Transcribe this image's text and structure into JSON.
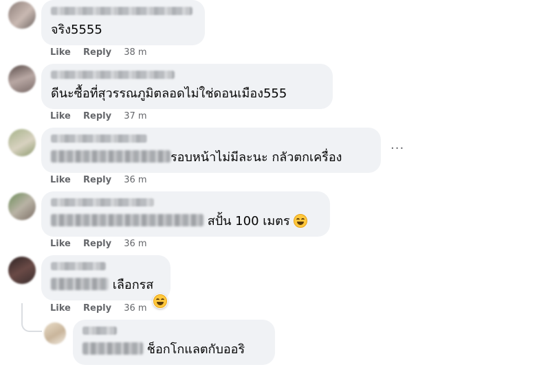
{
  "actions": {
    "like": "Like",
    "reply": "Reply"
  },
  "comments": [
    {
      "text": "จริง5555",
      "time": "38 m"
    },
    {
      "text": "ดีนะซื้อที่สุวรรณภูมิตลอดไม่ใช่ดอนเมือง555",
      "time": "37 m"
    },
    {
      "text": "รอบหน้าไม่มีละนะ กลัวตกเครื่อง",
      "time": "36 m"
    },
    {
      "text": "สปั้น 100 เมตร",
      "time": "36 m",
      "emoji": "grinning-squinting-face"
    },
    {
      "text": "เลือกรส",
      "time": "36 m",
      "reaction": "laughing-face"
    },
    {
      "text": "ช็อกโกแลตกับออริ"
    }
  ],
  "more_icon": "ellipsis-icon",
  "colors": {
    "bubble": "#f0f2f5",
    "meta_text": "#65676b",
    "body_text": "#050505"
  }
}
